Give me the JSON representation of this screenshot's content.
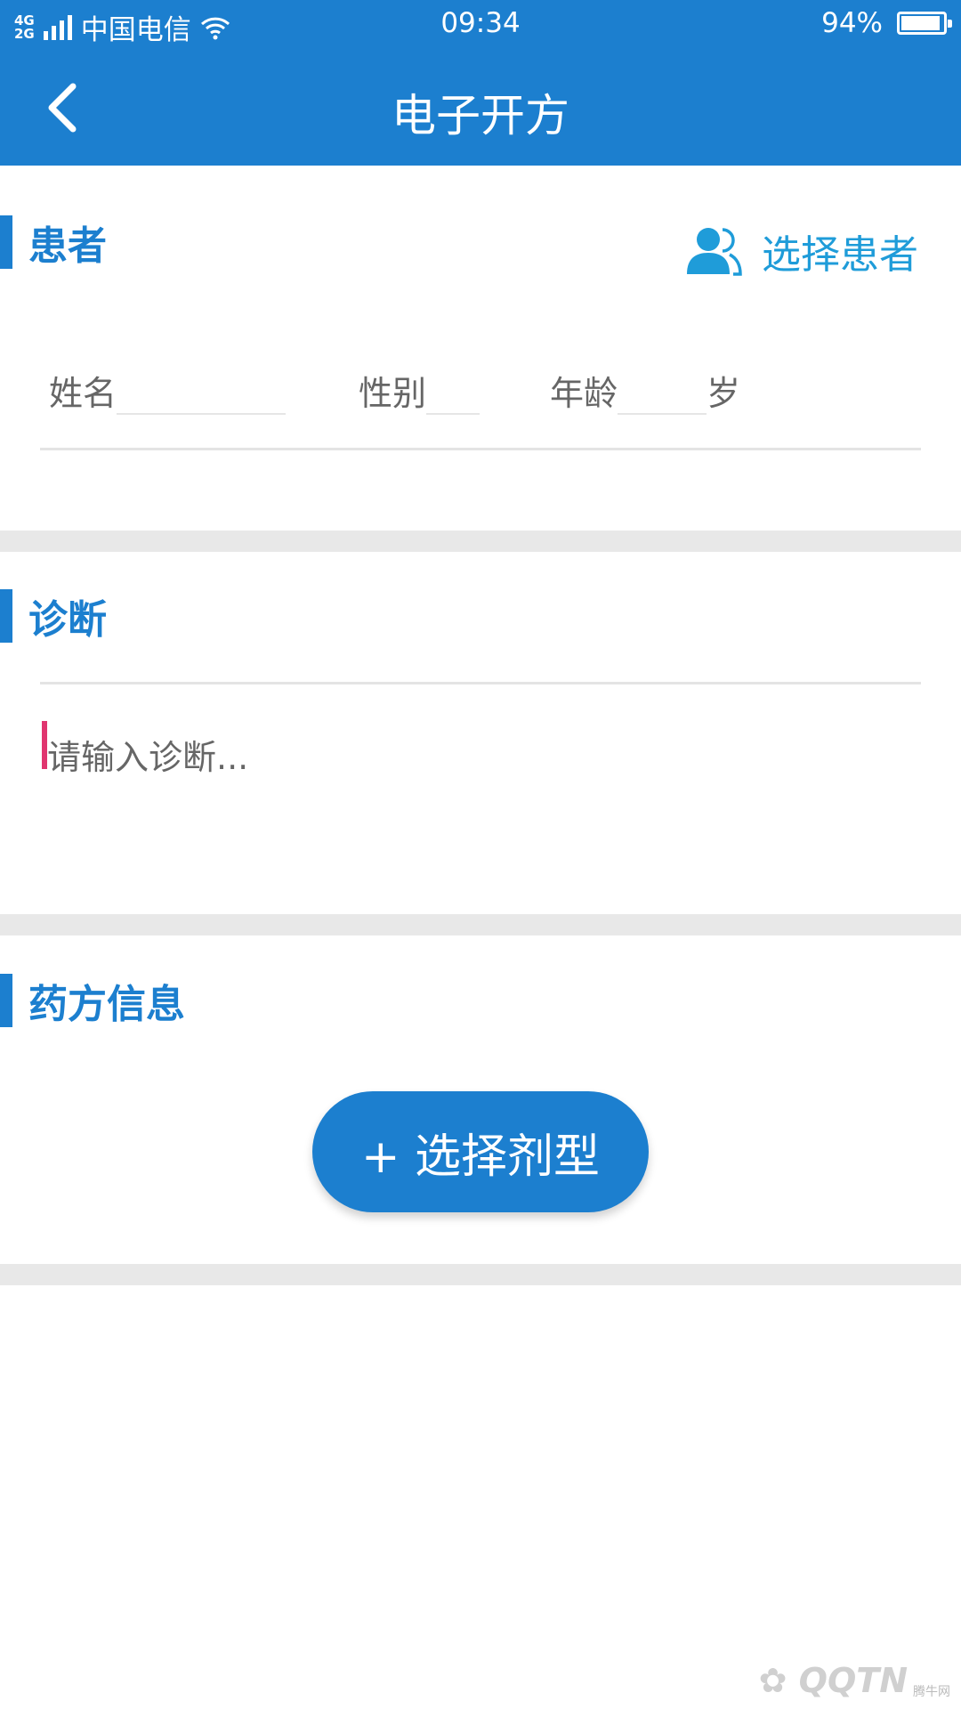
{
  "status_bar": {
    "network_top": "4G",
    "network_bottom": "2G",
    "carrier": "中国电信",
    "time": "09:34",
    "battery": "94%",
    "battery_level": 0.94
  },
  "header": {
    "title": "电子开方"
  },
  "patient": {
    "section_title": "患者",
    "select_label": "选择患者",
    "name_label": "姓名",
    "gender_label": "性别",
    "age_label": "年龄",
    "age_unit": "岁"
  },
  "diagnosis": {
    "section_title": "诊断",
    "placeholder": "请输入诊断..."
  },
  "prescription": {
    "section_title": "药方信息",
    "add_type_label": "+ 选择剂型"
  },
  "watermark": {
    "site_cn": "腾牛网"
  },
  "colors": {
    "primary": "#1c7fcf",
    "link": "#1f9cd9",
    "caret": "#e0356f",
    "band": "#e8e8e8"
  }
}
